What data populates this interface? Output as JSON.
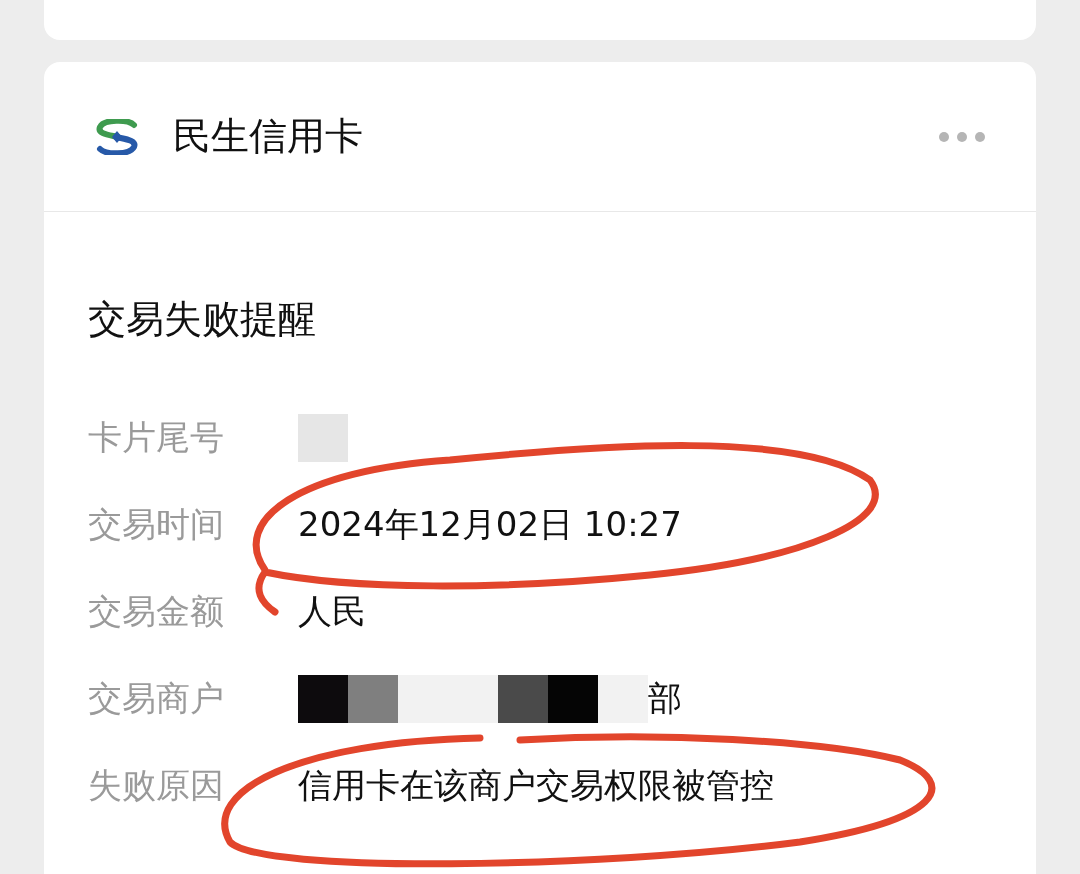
{
  "card": {
    "sender": "民生信用卡",
    "title": "交易失败提醒",
    "rows": [
      {
        "label": "卡片尾号",
        "value": [
          {
            "kind": "redacted",
            "color": "#e6e6e6"
          }
        ]
      },
      {
        "label": "交易时间",
        "value": [
          {
            "kind": "text",
            "text": "2024年12月02日 10:27"
          }
        ]
      },
      {
        "label": "交易金额",
        "value": [
          {
            "kind": "text",
            "text": "人民"
          }
        ]
      },
      {
        "label": "交易商户",
        "value": [
          {
            "kind": "redacted",
            "color": "#0d0b0d"
          },
          {
            "kind": "redacted",
            "color": "#7f7f7f"
          },
          {
            "kind": "redacted",
            "color": "#f2f2f2"
          },
          {
            "kind": "redacted",
            "color": "#f2f2f2"
          },
          {
            "kind": "redacted",
            "color": "#4a4a4a"
          },
          {
            "kind": "redacted",
            "color": "#050505"
          },
          {
            "kind": "redacted",
            "color": "#f2f2f2"
          },
          {
            "kind": "text",
            "text": "部"
          }
        ]
      },
      {
        "label": "失败原因",
        "value": [
          {
            "kind": "text",
            "text": "信用卡在该商户交易权限被管控"
          }
        ]
      }
    ]
  }
}
